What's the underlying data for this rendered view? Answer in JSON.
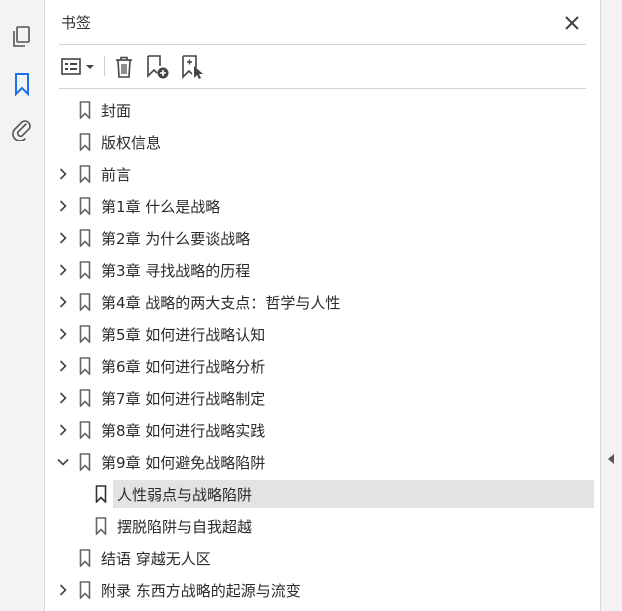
{
  "panel": {
    "title": "书签"
  },
  "rail": {
    "items": [
      {
        "name": "pages-icon"
      },
      {
        "name": "bookmark-icon"
      },
      {
        "name": "attachment-icon"
      }
    ]
  },
  "toolbar": {
    "buttons": [
      {
        "name": "options-menu-icon"
      },
      {
        "name": "delete-bookmark-icon"
      },
      {
        "name": "new-bookmark-icon"
      },
      {
        "name": "new-bookmark-from-structure-icon"
      }
    ]
  },
  "bookmarks": [
    {
      "label": "封面",
      "level": 0,
      "expander": "none",
      "selected": false
    },
    {
      "label": "版权信息",
      "level": 0,
      "expander": "none",
      "selected": false
    },
    {
      "label": "前言",
      "level": 0,
      "expander": "collapsed",
      "selected": false
    },
    {
      "label": "第1章 什么是战略",
      "level": 0,
      "expander": "collapsed",
      "selected": false
    },
    {
      "label": "第2章 为什么要谈战略",
      "level": 0,
      "expander": "collapsed",
      "selected": false
    },
    {
      "label": "第3章 寻找战略的历程",
      "level": 0,
      "expander": "collapsed",
      "selected": false
    },
    {
      "label": "第4章 战略的两大支点：哲学与人性",
      "level": 0,
      "expander": "collapsed",
      "selected": false
    },
    {
      "label": "第5章 如何进行战略认知",
      "level": 0,
      "expander": "collapsed",
      "selected": false
    },
    {
      "label": "第6章 如何进行战略分析",
      "level": 0,
      "expander": "collapsed",
      "selected": false
    },
    {
      "label": "第7章 如何进行战略制定",
      "level": 0,
      "expander": "collapsed",
      "selected": false
    },
    {
      "label": "第8章 如何进行战略实践",
      "level": 0,
      "expander": "collapsed",
      "selected": false
    },
    {
      "label": "第9章 如何避免战略陷阱",
      "level": 0,
      "expander": "expanded",
      "selected": false
    },
    {
      "label": "人性弱点与战略陷阱",
      "level": 1,
      "expander": "none",
      "selected": true
    },
    {
      "label": "摆脱陷阱与自我超越",
      "level": 1,
      "expander": "none",
      "selected": false
    },
    {
      "label": "结语 穿越无人区",
      "level": 0,
      "expander": "none",
      "selected": false
    },
    {
      "label": "附录 东西方战略的起源与流变",
      "level": 0,
      "expander": "collapsed",
      "selected": false
    }
  ]
}
